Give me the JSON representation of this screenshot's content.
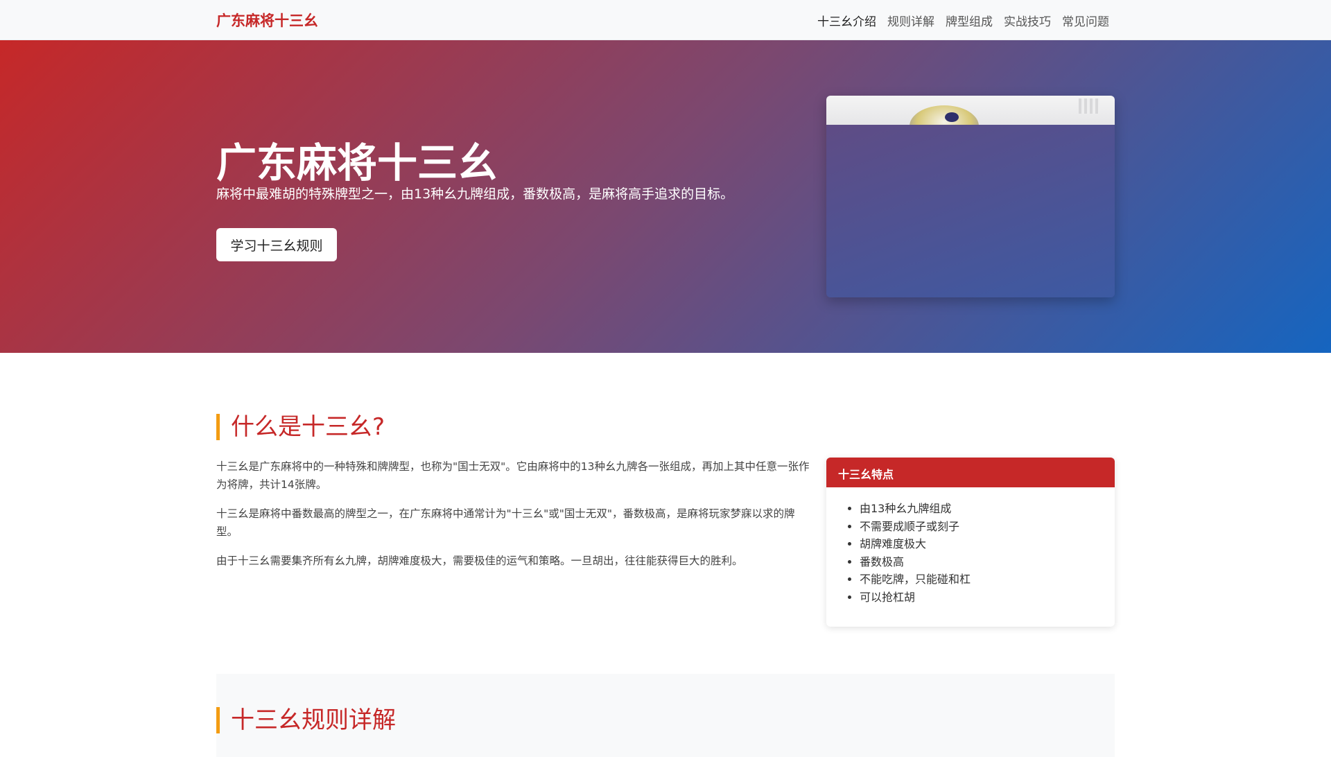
{
  "navbar": {
    "brand": "广东麻将十三幺",
    "links": [
      "十三幺介绍",
      "规则详解",
      "牌型组成",
      "实战技巧",
      "常见问题"
    ]
  },
  "hero": {
    "title": "广东麻将十三幺",
    "subtitle": "麻将中最难胡的特殊牌型之一，由13种幺九牌组成，番数极高，是麻将高手追求的目标。",
    "button_label": "学习十三幺规则"
  },
  "intro": {
    "heading": "什么是十三幺?",
    "paragraphs": [
      "十三幺是广东麻将中的一种特殊和牌牌型，也称为\"国士无双\"。它由麻将中的13种幺九牌各一张组成，再加上其中任意一张作为将牌，共计14张牌。",
      "十三幺是麻将中番数最高的牌型之一，在广东麻将中通常计为\"十三幺\"或\"国士无双\"，番数极高，是麻将玩家梦寐以求的牌型。",
      "由于十三幺需要集齐所有幺九牌，胡牌难度极大，需要极佳的运气和策略。一旦胡出，往往能获得巨大的胜利。"
    ]
  },
  "features": {
    "title": "十三幺特点",
    "items": [
      "由13种幺九牌组成",
      "不需要成顺子或刻子",
      "胡牌难度极大",
      "番数极高",
      "不能吃牌，只能碰和杠",
      "可以抢杠胡"
    ]
  },
  "rules": {
    "heading": "十三幺规则详解"
  },
  "colors": {
    "brand_red": "#c62828",
    "accent_orange": "#f39c12",
    "hero_blue": "#1565c0"
  }
}
